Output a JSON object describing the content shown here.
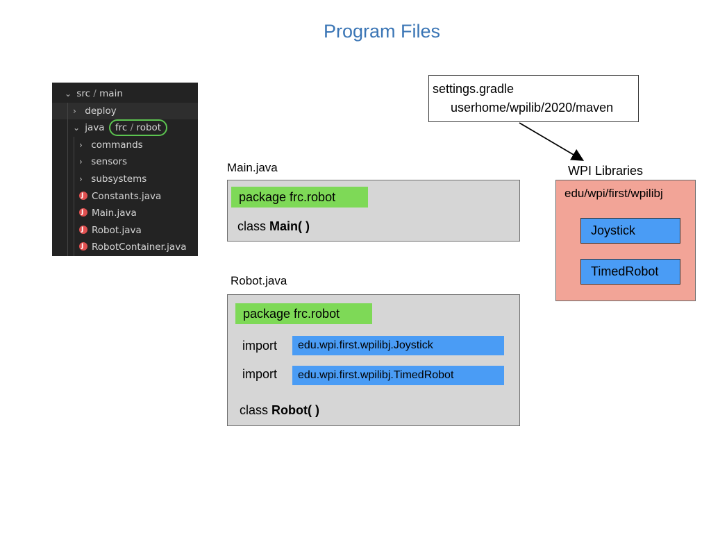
{
  "title": "Program Files",
  "tree": {
    "root": {
      "a": "src",
      "b": "main"
    },
    "deploy": "deploy",
    "java": "java",
    "pkg": {
      "a": "frc",
      "b": "robot"
    },
    "folders": [
      "commands",
      "sensors",
      "subsystems"
    ],
    "files": [
      "Constants.java",
      "Main.java",
      "Robot.java",
      "RobotContainer.java"
    ]
  },
  "main_java": {
    "filename": "Main.java",
    "package": "package  frc.robot",
    "class_kw": "class ",
    "class_name": "Main( )"
  },
  "robot_java": {
    "filename": "Robot.java",
    "package": "package  frc.robot",
    "import_kw": "import",
    "imports": [
      "edu.wpi.first.wpilibj.Joystick",
      "edu.wpi.first.wpilibj.TimedRobot"
    ],
    "class_kw": "class ",
    "class_name": "Robot( )"
  },
  "settings": {
    "line1": "settings.gradle",
    "line2": "userhome/wpilib/2020/maven"
  },
  "wpi": {
    "label": "WPI Libraries",
    "path": "edu/wpi/first/wpilibj",
    "classes": [
      "Joystick",
      "TimedRobot"
    ]
  }
}
